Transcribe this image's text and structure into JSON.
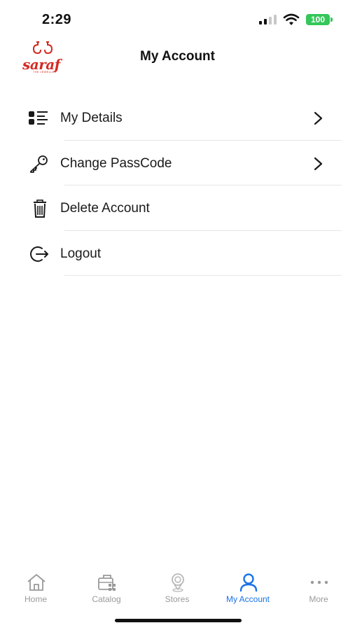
{
  "status_bar": {
    "time": "2:29",
    "battery": "100",
    "icons": [
      "signal-icon",
      "wifi-icon",
      "battery-icon"
    ]
  },
  "header": {
    "logo_text": "saraf",
    "logo_subtext": "THE JEWELLER",
    "title": "My Account"
  },
  "menu": {
    "items": [
      {
        "label": "My Details",
        "icon": "details-list-icon",
        "has_chevron": true
      },
      {
        "label": "Change PassCode",
        "icon": "key-icon",
        "has_chevron": true
      },
      {
        "label": "Delete Account",
        "icon": "trash-icon",
        "has_chevron": false
      },
      {
        "label": "Logout",
        "icon": "logout-icon",
        "has_chevron": false
      }
    ]
  },
  "tab_bar": {
    "tabs": [
      {
        "label": "Home",
        "icon": "home-icon",
        "active": false
      },
      {
        "label": "Catalog",
        "icon": "catalog-icon",
        "active": false
      },
      {
        "label": "Stores",
        "icon": "stores-icon",
        "active": false
      },
      {
        "label": "My Account",
        "icon": "user-icon",
        "active": true
      },
      {
        "label": "More",
        "icon": "more-icon",
        "active": false
      }
    ]
  },
  "colors": {
    "brand": "#d42a22",
    "active_tab": "#1a73e8",
    "inactive_tab": "#9a9a9a",
    "battery": "#34c759"
  }
}
